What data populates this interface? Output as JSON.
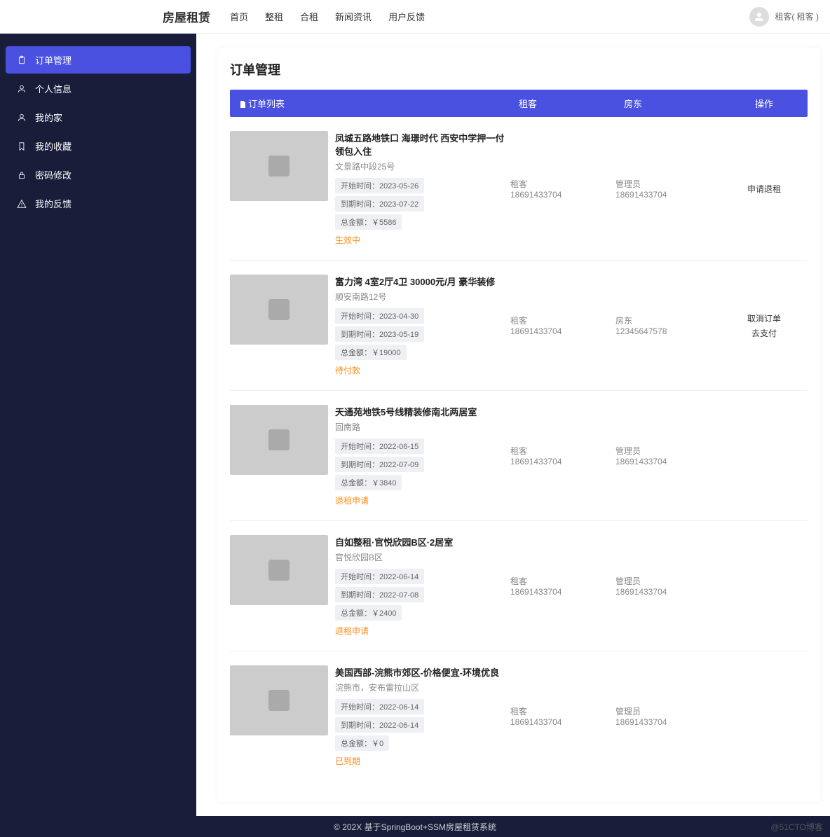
{
  "header": {
    "brand": "房屋租赁",
    "nav": [
      "首页",
      "整租",
      "合租",
      "新闻资讯",
      "用户反馈"
    ],
    "user_label": "租客( 租客 )"
  },
  "sidebar": {
    "items": [
      {
        "icon": "clipboard",
        "label": "订单管理",
        "active": true
      },
      {
        "icon": "user",
        "label": "个人信息",
        "active": false
      },
      {
        "icon": "home",
        "label": "我的家",
        "active": false
      },
      {
        "icon": "bookmark",
        "label": "我的收藏",
        "active": false
      },
      {
        "icon": "lock",
        "label": "密码修改",
        "active": false
      },
      {
        "icon": "warning",
        "label": "我的反馈",
        "active": false
      }
    ]
  },
  "page": {
    "title": "订单管理",
    "columns": {
      "list": "订单列表",
      "tenant": "租客",
      "landlord": "房东",
      "action": "操作"
    },
    "labels": {
      "start": "开始时间：",
      "end": "到期时间：",
      "total": "总金额："
    }
  },
  "orders": [
    {
      "title": "凤城五路地铁口 海璟时代 西安中学押一付 领包入住",
      "address": "文景路中段25号",
      "start": "2023-05-26",
      "end": "2023-07-22",
      "total": "￥5586",
      "status": "生效中",
      "tenant_role": "租客",
      "tenant_phone": "18691433704",
      "landlord_role": "管理员",
      "landlord_phone": "18691433704",
      "actions": [
        "申请退租"
      ]
    },
    {
      "title": "富力湾 4室2厅4卫 30000元/月 豪华装修",
      "address": "顺安南路12号",
      "start": "2023-04-30",
      "end": "2023-05-19",
      "total": "￥19000",
      "status": "待付款",
      "tenant_role": "租客",
      "tenant_phone": "18691433704",
      "landlord_role": "房东",
      "landlord_phone": "12345647578",
      "actions": [
        "取消订单",
        "去支付"
      ]
    },
    {
      "title": "天通苑地铁5号线精装修南北两居室",
      "address": "回南路",
      "start": "2022-06-15",
      "end": "2022-07-09",
      "total": "￥3840",
      "status": "退租申请",
      "tenant_role": "租客",
      "tenant_phone": "18691433704",
      "landlord_role": "管理员",
      "landlord_phone": "18691433704",
      "actions": []
    },
    {
      "title": "自如整租·官悦欣园B区·2居室",
      "address": "官悦欣园B区",
      "start": "2022-06-14",
      "end": "2022-07-08",
      "total": "￥2400",
      "status": "退租申请",
      "tenant_role": "租客",
      "tenant_phone": "18691433704",
      "landlord_role": "管理员",
      "landlord_phone": "18691433704",
      "actions": []
    },
    {
      "title": "美国西部-浣熊市郊区-价格便宜-环境优良",
      "address": "浣熊市，安布雷拉山区",
      "start": "2022-06-14",
      "end": "2022-06-14",
      "total": "￥0",
      "status": "已到期",
      "tenant_role": "租客",
      "tenant_phone": "18691433704",
      "landlord_role": "管理员",
      "landlord_phone": "18691433704",
      "actions": []
    }
  ],
  "footer": {
    "text": "© 202X 基于SpringBoot+SSM房屋租赁系统",
    "watermark": "@51CTO博客"
  }
}
